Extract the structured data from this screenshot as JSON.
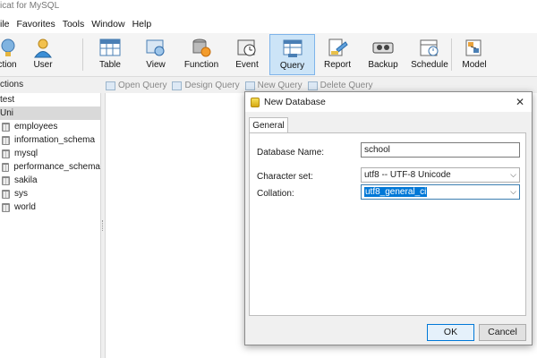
{
  "app": {
    "title": "icat for MySQL"
  },
  "menu": [
    "ile",
    "Favorites",
    "Tools",
    "Window",
    "Help"
  ],
  "toolbar": {
    "buttons": [
      {
        "label": "ction",
        "icon": "connection-icon"
      },
      {
        "label": "User",
        "icon": "user-icon"
      },
      {
        "label": "Table",
        "icon": "table-icon"
      },
      {
        "label": "View",
        "icon": "view-icon"
      },
      {
        "label": "Function",
        "icon": "function-icon"
      },
      {
        "label": "Event",
        "icon": "event-icon"
      },
      {
        "label": "Query",
        "icon": "query-icon"
      },
      {
        "label": "Report",
        "icon": "report-icon"
      },
      {
        "label": "Backup",
        "icon": "backup-icon"
      },
      {
        "label": "Schedule",
        "icon": "schedule-icon"
      },
      {
        "label": "Model",
        "icon": "model-icon"
      }
    ]
  },
  "subbar": {
    "open_query": "Open Query",
    "design_query": "Design Query",
    "new_query": "New Query",
    "delete_query": "Delete Query"
  },
  "sidebar": {
    "header": "ctions",
    "items": [
      "test",
      "Uni",
      "employees",
      "information_schema",
      "mysql",
      "performance_schema",
      "sakila",
      "sys",
      "world"
    ]
  },
  "dialog": {
    "title": "New Database",
    "tab_general": "General",
    "db_name_label": "Database Name:",
    "db_name_value": "school",
    "charset_label": "Character set:",
    "charset_value": "utf8 -- UTF-8 Unicode",
    "collation_label": "Collation:",
    "collation_value": "utf8_general_ci",
    "ok": "OK",
    "cancel": "Cancel",
    "close_glyph": "✕"
  },
  "colors": {
    "selection": "#cce4f7",
    "accent": "#0078d7"
  }
}
